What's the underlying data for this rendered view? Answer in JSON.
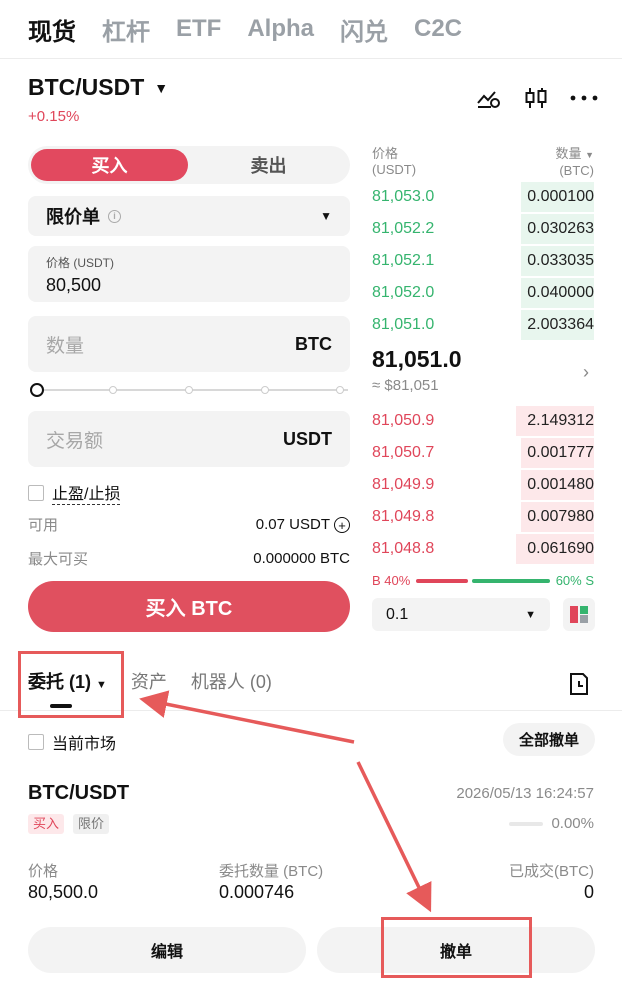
{
  "top_tabs": [
    "现货",
    "杠杆",
    "ETF",
    "Alpha",
    "闪兑",
    "C2C"
  ],
  "pair": {
    "symbol": "BTC/USDT",
    "change": "+0.15%"
  },
  "header_icons": [
    "chart-toggle-icon",
    "candlestick-icon",
    "more-icon"
  ],
  "trade": {
    "buy_label": "买入",
    "sell_label": "卖出",
    "order_type": "限价单",
    "price_label": "价格 (USDT)",
    "price_value": "80,500",
    "qty_placeholder": "数量",
    "qty_unit": "BTC",
    "amount_placeholder": "交易额",
    "amount_unit": "USDT",
    "tpsl_label": "止盈/止损",
    "available_label": "可用",
    "available_value": "0.07 USDT",
    "max_buy_label": "最大可买",
    "max_buy_value": "0.000000 BTC",
    "submit_label": "买入 BTC",
    "slider_percent": 0
  },
  "orderbook": {
    "price_header": "价格",
    "price_unit": "(USDT)",
    "qty_header": "数量",
    "qty_unit": "(BTC)",
    "asks": [
      {
        "price": "81,053.0",
        "qty": "0.000100",
        "depth": 0.33
      },
      {
        "price": "81,052.2",
        "qty": "0.030263",
        "depth": 0.33
      },
      {
        "price": "81,052.1",
        "qty": "0.033035",
        "depth": 0.33
      },
      {
        "price": "81,052.0",
        "qty": "0.040000",
        "depth": 0.33
      },
      {
        "price": "81,051.0",
        "qty": "2.003364",
        "depth": 0.33
      }
    ],
    "last_price": "81,051.0",
    "last_price_usd": "≈ $81,051",
    "bids": [
      {
        "price": "81,050.9",
        "qty": "2.149312",
        "depth": 0.35
      },
      {
        "price": "81,050.7",
        "qty": "0.001777",
        "depth": 0.33
      },
      {
        "price": "81,049.9",
        "qty": "0.001480",
        "depth": 0.33
      },
      {
        "price": "81,049.8",
        "qty": "0.007980",
        "depth": 0.33
      },
      {
        "price": "81,048.8",
        "qty": "0.061690",
        "depth": 0.35
      }
    ],
    "buy_ratio_label": "B 40%",
    "sell_ratio_label": "60% S",
    "buy_ratio": 0.4,
    "depth_value": "0.1"
  },
  "orders_tabs": {
    "open_orders": "委托 (1)",
    "assets": "资产",
    "bots": "机器人 (0)"
  },
  "filter": {
    "current_market": "当前市场",
    "cancel_all": "全部撤单"
  },
  "order": {
    "pair": "BTC/USDT",
    "time": "2026/05/13 16:24:57",
    "side_tag": "买入",
    "type_tag": "限价",
    "filled_percent": "0.00%",
    "filled_fraction": 0,
    "price_label": "价格",
    "price_value": "80,500.0",
    "qty_label": "委托数量 (BTC)",
    "qty_value": "0.000746",
    "filled_label": "已成交(BTC)",
    "filled_value": "0",
    "edit_label": "编辑",
    "cancel_label": "撤单"
  },
  "colors": {
    "buy": "#e2495f",
    "sell": "#35b46e",
    "annotation": "#e65a5a"
  }
}
